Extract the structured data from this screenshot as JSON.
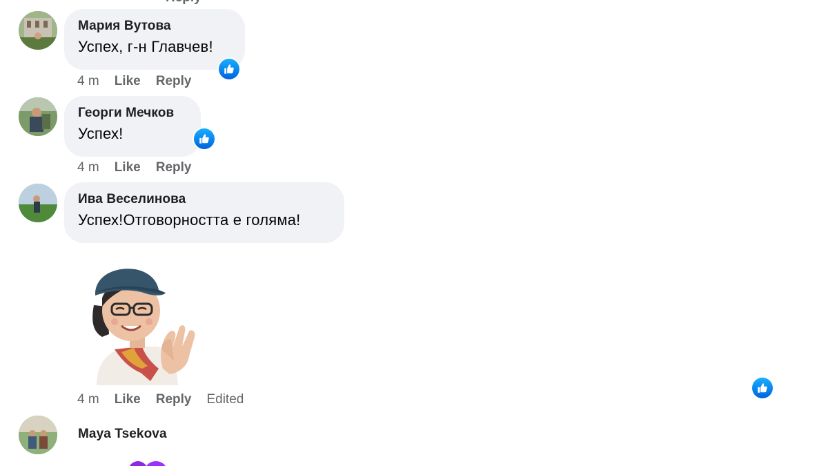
{
  "header_cut": {
    "reply_partial": "Reply"
  },
  "comments": [
    {
      "author": "Мария Вутова",
      "text": "Успех, г-н Главчев!",
      "time": "4 m",
      "like_label": "Like",
      "reply_label": "Reply",
      "reaction": "like"
    },
    {
      "author": "Георги Мечков",
      "text": "Успех!",
      "time": "4 m",
      "like_label": "Like",
      "reply_label": "Reply",
      "reaction": "like"
    },
    {
      "author": "Ива Веселинова",
      "text": "Успех!Отговорността е голяма!",
      "time": "4 m",
      "like_label": "Like",
      "reply_label": "Reply",
      "edited_label": "Edited",
      "attachment": "avatar-sticker-clapping",
      "reaction": "like"
    },
    {
      "author": "Maya Tsekova"
    }
  ],
  "colors": {
    "bubble": "#f0f2f5",
    "meta_text": "#65676b",
    "like_blue": "#1877f2"
  }
}
